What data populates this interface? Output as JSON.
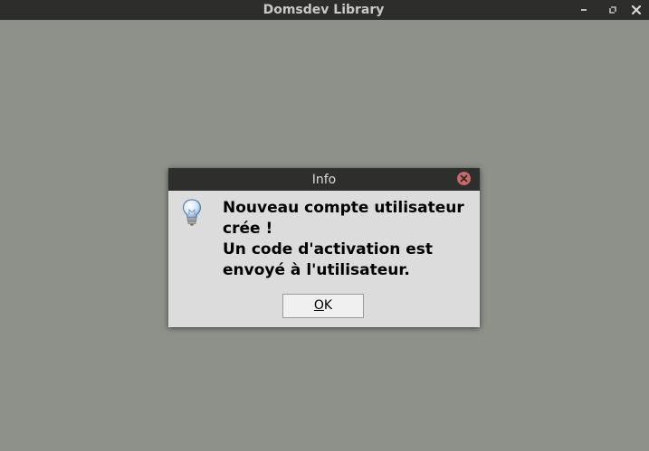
{
  "window": {
    "title": "Domsdev Library",
    "controls": [
      "minimize-icon",
      "restore-icon",
      "close-icon"
    ]
  },
  "dialog": {
    "title": "Info",
    "icon": "lightbulb-info-icon",
    "message_lines": [
      "Nouveau compte utilisateur",
      "crée !",
      "Un code d'activation est",
      "envoyé à l'utilisateur."
    ],
    "ok_button": {
      "mnemonic": "O",
      "rest": "K"
    }
  },
  "colors": {
    "desktop_background": "#8d918a",
    "titlebar": "#2d2d2b",
    "dialog_background": "#dcdcdc",
    "dialog_close": "#c66a6a"
  }
}
